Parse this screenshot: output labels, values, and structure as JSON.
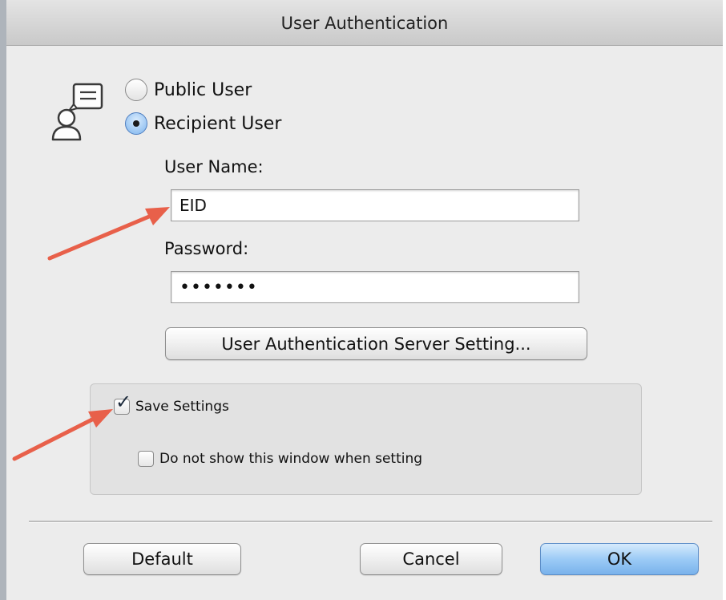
{
  "window": {
    "title": "User Authentication"
  },
  "icons": {
    "user_icon": "user-chat-icon",
    "checkmark_glyph": "✓",
    "colors": {
      "arrow": "#e8604a",
      "default_button": "#7ab4ec",
      "radio_selected": "#7eb4ee"
    }
  },
  "user_type": {
    "options": [
      {
        "label": "Public User",
        "selected": false
      },
      {
        "label": "Recipient User",
        "selected": true
      }
    ]
  },
  "fields": {
    "username": {
      "label": "User Name:",
      "value": "EID"
    },
    "password": {
      "label": "Password:",
      "masked_value": "•••••••"
    }
  },
  "server_button": {
    "label": "User Authentication Server Setting..."
  },
  "settings_group": {
    "save_settings": {
      "label": "Save Settings",
      "checked": true
    },
    "hide_window": {
      "label": "Do not show this window when setting",
      "checked": false
    }
  },
  "footer": {
    "default_label": "Default",
    "cancel_label": "Cancel",
    "ok_label": "OK"
  }
}
